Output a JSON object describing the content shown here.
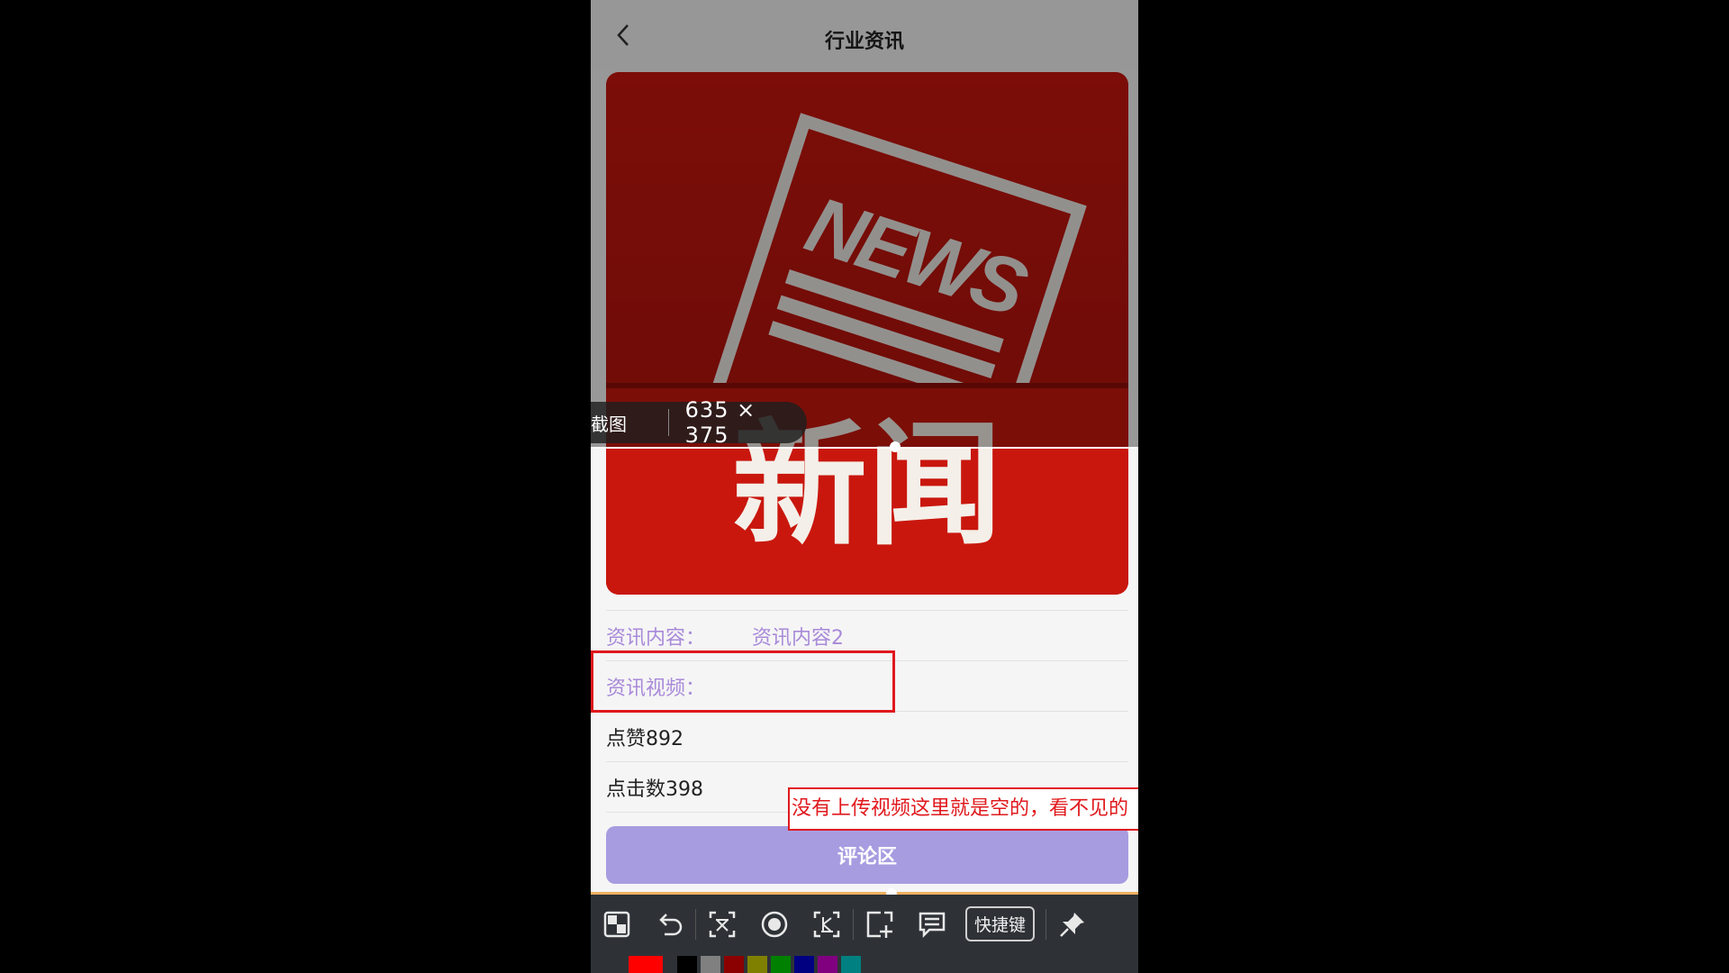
{
  "app": {
    "title": "行业资讯"
  },
  "news_image": {
    "headline": "NEWS",
    "caption": "新闻"
  },
  "details": {
    "content_label": "资讯内容：",
    "content_value": "资讯内容2",
    "video_label": "资讯视频：",
    "likes": "点赞892",
    "clicks": "点击数398"
  },
  "comment_button": "评论区",
  "overlay": {
    "capture_label": "截图",
    "size": "635 × 375",
    "annotation": "没有上传视频这里就是空的，看不见的"
  },
  "toolbar": {
    "shortcut_label": "快捷键"
  },
  "palette": {
    "current": "#ff0000",
    "colors": [
      "#000000",
      "#808080",
      "#8b0000",
      "#808000",
      "#008000",
      "#000080",
      "#800080",
      "#008080"
    ]
  },
  "colors": {
    "accent": "#a79ce0",
    "label": "#a98ad9",
    "annotation": "#e0191d"
  }
}
